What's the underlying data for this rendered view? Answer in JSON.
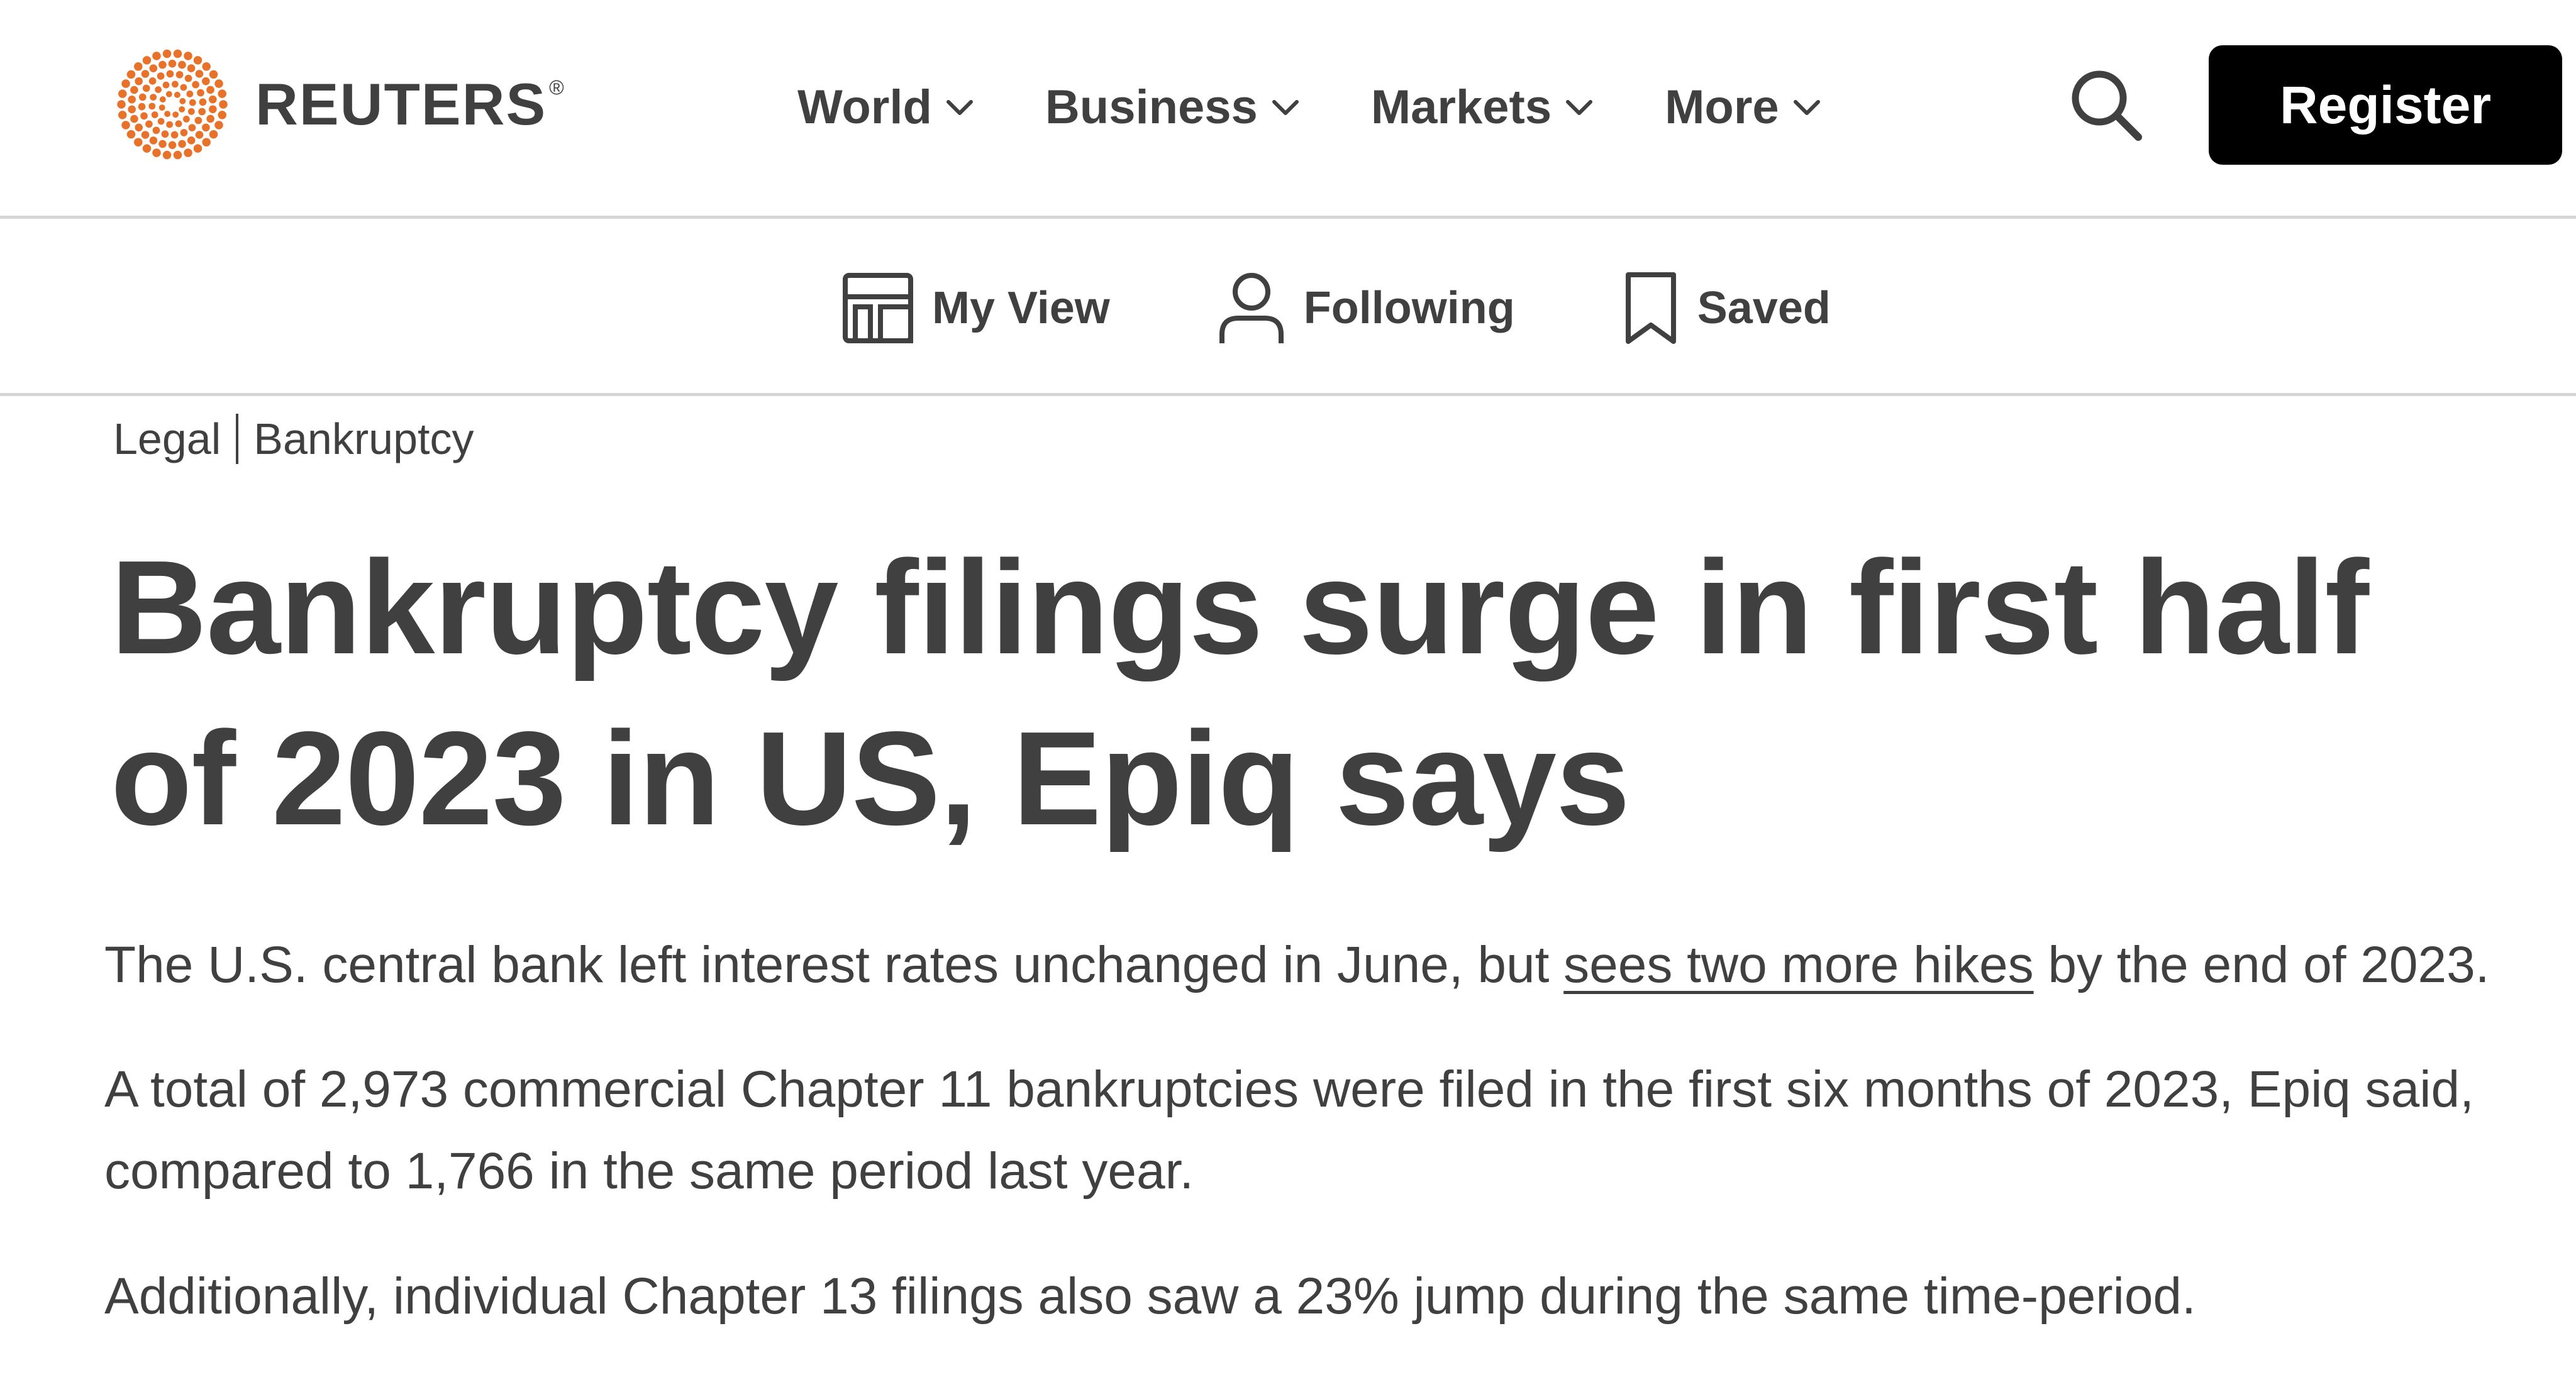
{
  "header": {
    "brand": "REUTERS",
    "brand_mark": "®",
    "nav": [
      {
        "label": "World"
      },
      {
        "label": "Business"
      },
      {
        "label": "Markets"
      },
      {
        "label": "More"
      }
    ],
    "register_label": "Register"
  },
  "subnav": [
    {
      "label": "My View",
      "icon": "layout-icon"
    },
    {
      "label": "Following",
      "icon": "person-icon"
    },
    {
      "label": "Saved",
      "icon": "bookmark-icon"
    }
  ],
  "article": {
    "breadcrumb": [
      "Legal",
      "Bankruptcy"
    ],
    "headline": "Bankruptcy filings surge in first half of 2023 in US, Epiq says",
    "p1": {
      "before": "The U.S. central bank left interest rates unchanged in June, but ",
      "link": "sees two more hikes",
      "after": " by the end of 2023."
    },
    "p2": "A total of 2,973 commercial Chapter 11 bankruptcies were filed in the first six months of 2023, Epiq said, compared to 1,766 in the same period last year.",
    "p3": "Additionally, individual Chapter 13 filings also saw a 23% jump during the same time-period."
  },
  "colors": {
    "brand_orange": "#e8722a",
    "text": "#404040",
    "divider": "#d6d6d6",
    "button_bg": "#000000",
    "button_text": "#ffffff"
  }
}
